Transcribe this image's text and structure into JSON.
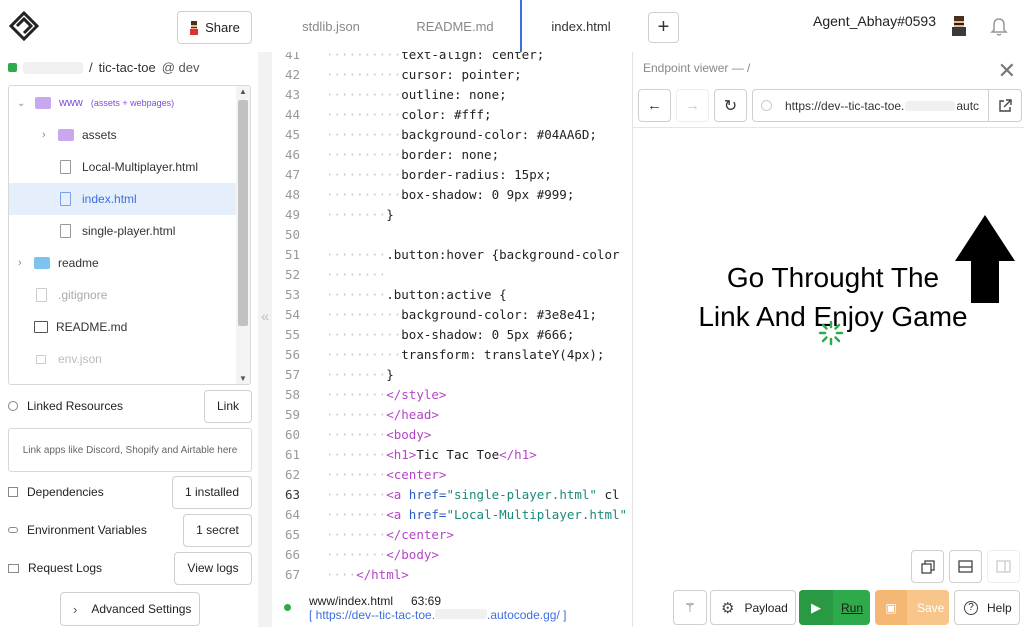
{
  "header": {
    "share_label": "Share",
    "tabs": [
      {
        "label": "stdlib.json"
      },
      {
        "label": "README.md"
      },
      {
        "label": "index.html"
      }
    ],
    "username": "Agent_Abhay#0593"
  },
  "sidebar": {
    "breadcrumb_sep": "/",
    "project": "tic-tac-toe",
    "env": "@ dev",
    "tree": [
      {
        "label": "www",
        "hint": "(assets + webpages)"
      },
      {
        "label": "assets"
      },
      {
        "label": "Local-Multiplayer.html"
      },
      {
        "label": "index.html"
      },
      {
        "label": "single-player.html"
      },
      {
        "label": "readme"
      },
      {
        "label": ".gitignore"
      },
      {
        "label": "README.md"
      },
      {
        "label": "env.json"
      }
    ],
    "linked_resources_label": "Linked Resources",
    "link_button": "Link",
    "link_hint": "Link apps like Discord, Shopify and Airtable here",
    "dependencies_label": "Dependencies",
    "dependencies_button": "1 installed",
    "envvars_label": "Environment Variables",
    "envvars_button": "1 secret",
    "logs_label": "Request Logs",
    "logs_button": "View logs",
    "advanced_label": "Advanced Settings"
  },
  "editor": {
    "lines": [
      {
        "n": "41",
        "indent": "··········",
        "text": "text-align: center;"
      },
      {
        "n": "42",
        "indent": "··········",
        "text": "cursor: pointer;"
      },
      {
        "n": "43",
        "indent": "··········",
        "text": "outline: none;"
      },
      {
        "n": "44",
        "indent": "··········",
        "text": "color: #fff;"
      },
      {
        "n": "45",
        "indent": "··········",
        "text": "background-color: #04AA6D;"
      },
      {
        "n": "46",
        "indent": "··········",
        "text": "border: none;"
      },
      {
        "n": "47",
        "indent": "··········",
        "text": "border-radius: 15px;"
      },
      {
        "n": "48",
        "indent": "··········",
        "text": "box-shadow: 0 9px #999;"
      },
      {
        "n": "49",
        "indent": "········",
        "text": "}"
      },
      {
        "n": "50",
        "indent": "",
        "text": ""
      },
      {
        "n": "51",
        "indent": "········",
        "text": ".button:hover {background-color"
      },
      {
        "n": "52",
        "indent": "········",
        "text": ""
      },
      {
        "n": "53",
        "indent": "········",
        "text": ".button:active {"
      },
      {
        "n": "54",
        "indent": "··········",
        "text": "background-color: #3e8e41;"
      },
      {
        "n": "55",
        "indent": "··········",
        "text": "box-shadow: 0 5px #666;"
      },
      {
        "n": "56",
        "indent": "··········",
        "text": "transform: translateY(4px);"
      },
      {
        "n": "57",
        "indent": "········",
        "text": "}"
      },
      {
        "n": "58",
        "indent": "········",
        "tag": "</style>"
      },
      {
        "n": "59",
        "indent": "········",
        "tag": "</head>"
      },
      {
        "n": "60",
        "indent": "········",
        "tag": "<body>"
      },
      {
        "n": "61",
        "indent": "········",
        "tag": "<h1>",
        "text": "Tic Tac Toe",
        "tag2": "</h1>"
      },
      {
        "n": "62",
        "indent": "········",
        "tag": "<center>"
      },
      {
        "n": "63",
        "indent": "········",
        "tag": "<a ",
        "attr": "href=",
        "str": "\"single-player.html\"",
        "rest": " cl"
      },
      {
        "n": "64",
        "indent": "········",
        "tag": "<a ",
        "attr": "href=",
        "str": "\"Local-Multiplayer.html\""
      },
      {
        "n": "65",
        "indent": "········",
        "tag": "</center>"
      },
      {
        "n": "66",
        "indent": "········",
        "tag": "</body>"
      },
      {
        "n": "67",
        "indent": "····",
        "tag": "</html>"
      }
    ],
    "status_file": "www/index.html",
    "status_pos": "63:69",
    "status_url_prefix": "[ https://dev--tic-tac-toe.",
    "status_url_suffix": ".autocode.gg/ ]"
  },
  "viewer": {
    "title": "Endpoint viewer — /",
    "url_prefix": "https://dev--tic-tac-toe.",
    "url_suffix": "autc",
    "message_line1": "Go Throught The",
    "message_line2": "Link And Enjoy Game"
  },
  "actions": {
    "payload_label": "Payload",
    "run_label": "Run",
    "save_label": "Save",
    "help_label": "Help"
  },
  "colors": {
    "run_green": "#2faa4b",
    "save_orange": "#f8c58a",
    "accent_blue": "#3d6fe0",
    "folder_purple": "#c9a8f0",
    "folder_blue": "#7cc4ef"
  }
}
